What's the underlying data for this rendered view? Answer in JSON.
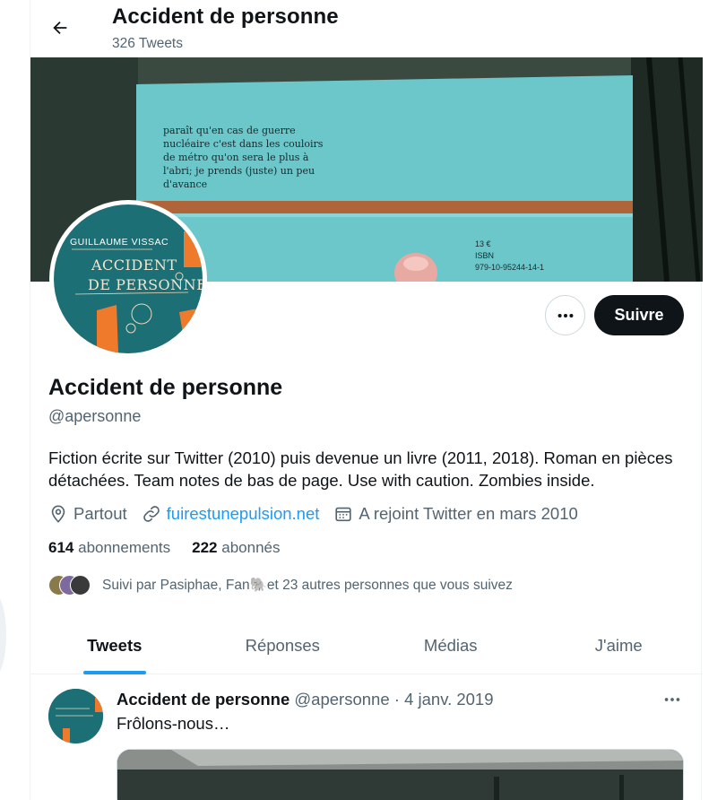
{
  "header": {
    "title": "Accident de personne",
    "tweet_count": "326 Tweets"
  },
  "banner": {
    "text_lines": [
      "paraît qu'en cas de guerre",
      "nucléaire c'est dans les couloirs",
      "de métro qu'on sera le plus à",
      "l'abri; je prends (juste) un peu",
      "d'avance"
    ],
    "price_lines": [
      "13 €",
      "ISBN",
      "979-10-95244-14-1"
    ]
  },
  "avatar": {
    "author": "GUILLAUME VISSAC",
    "title_line1": "ACCIDENT",
    "title_line2": "DE PERSONNE"
  },
  "actions": {
    "follow_label": "Suivre"
  },
  "profile": {
    "name": "Accident de personne",
    "handle": "@apersonne",
    "bio": "Fiction écrite sur Twitter (2010) puis devenue un livre (2011, 2018). Roman en pièces détachées. Team notes de bas de page. Use with caution. Zombies inside.",
    "location": "Partout",
    "website": "fuirestunepulsion.net",
    "joined": "A rejoint Twitter en mars 2010"
  },
  "stats": {
    "following_count": "614",
    "following_label": "abonnements",
    "followers_count": "222",
    "followers_label": "abonnés"
  },
  "followed_by": {
    "text_prefix": "Suivi par Pasiphae, Fan",
    "emoji": "🐘",
    "text_suffix": " et 23 autres personnes que vous suivez"
  },
  "tabs": [
    {
      "label": "Tweets",
      "active": true
    },
    {
      "label": "Réponses",
      "active": false
    },
    {
      "label": "Médias",
      "active": false
    },
    {
      "label": "J'aime",
      "active": false
    }
  ],
  "tweet": {
    "name": "Accident de personne",
    "handle": "@apersonne",
    "separator": "·",
    "date": "4 janv. 2019",
    "text": "Frôlons-nous…"
  },
  "colors": {
    "accent": "#1d9bf0",
    "text_primary": "#0f1419",
    "text_secondary": "#536471",
    "book_cover": "#1d6f76",
    "book_orange": "#f07a2c"
  },
  "icons": {
    "back": "arrow-left-icon",
    "more": "more-horizontal-icon",
    "location": "location-pin-icon",
    "link": "link-icon",
    "calendar": "calendar-icon"
  }
}
